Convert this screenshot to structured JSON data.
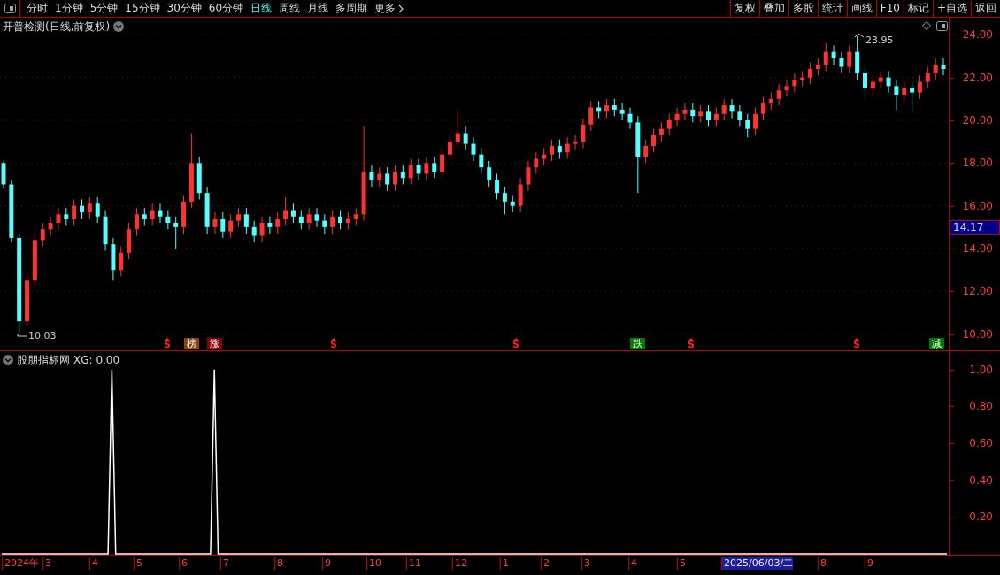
{
  "toolbar": {
    "tabs": [
      {
        "label": "分时",
        "selected": false
      },
      {
        "label": "1分钟",
        "selected": false
      },
      {
        "label": "5分钟",
        "selected": false
      },
      {
        "label": "15分钟",
        "selected": false
      },
      {
        "label": "30分钟",
        "selected": false
      },
      {
        "label": "60分钟",
        "selected": false
      },
      {
        "label": "日线",
        "selected": true
      },
      {
        "label": "周线",
        "selected": false
      },
      {
        "label": "月线",
        "selected": false
      },
      {
        "label": "多周期",
        "selected": false
      }
    ],
    "more": "更多",
    "buttons": [
      "复权",
      "叠加",
      "多股",
      "统计",
      "画线",
      "F10",
      "标记",
      "+自选",
      "返回"
    ]
  },
  "price_chart": {
    "title": "开普检测(日线,前复权)",
    "high_label": "23.95",
    "low_label": "10.03",
    "current_price": "14.17",
    "chart_data": {
      "type": "candlestick",
      "categories": [
        null,
        null,
        null,
        null,
        null,
        null,
        null,
        null,
        null,
        null,
        null,
        null,
        null,
        null,
        null,
        null,
        null,
        null,
        null,
        null,
        null,
        null,
        null,
        null,
        null,
        null,
        null,
        null,
        null,
        null,
        null,
        null,
        null,
        null,
        null,
        null,
        null,
        null,
        null,
        null,
        null,
        null,
        null,
        null,
        null,
        null,
        null,
        null,
        null,
        null,
        null,
        null,
        null,
        null,
        null,
        null,
        null,
        null,
        null,
        null,
        null,
        null,
        null,
        null,
        null,
        null,
        null,
        null,
        null,
        null,
        null,
        null,
        null,
        null,
        null,
        null,
        null,
        null,
        null,
        null,
        null,
        null,
        null,
        null,
        null,
        null,
        null,
        null,
        null,
        null,
        null,
        null,
        null,
        null,
        null,
        null,
        null,
        null,
        null,
        null,
        null,
        null,
        null,
        null,
        null,
        null,
        null,
        null,
        null,
        null,
        null,
        null,
        null,
        null,
        null,
        null,
        null,
        null,
        null,
        null,
        null
      ],
      "ohlc": [
        [
          18.0,
          18.1,
          16.8,
          17.0
        ],
        [
          17.0,
          17.2,
          14.3,
          14.5
        ],
        [
          14.5,
          14.7,
          10.03,
          10.6
        ],
        [
          10.6,
          12.8,
          10.4,
          12.5
        ],
        [
          12.5,
          14.7,
          12.3,
          14.4
        ],
        [
          14.4,
          15.2,
          14.1,
          14.9
        ],
        [
          14.9,
          15.5,
          14.6,
          15.2
        ],
        [
          15.2,
          15.9,
          14.9,
          15.6
        ],
        [
          15.6,
          15.9,
          15.1,
          15.4
        ],
        [
          15.4,
          16.3,
          15.1,
          16.0
        ],
        [
          16.0,
          16.3,
          15.4,
          15.7
        ],
        [
          15.7,
          16.4,
          15.4,
          16.1
        ],
        [
          16.1,
          16.4,
          15.2,
          15.5
        ],
        [
          15.5,
          15.8,
          13.9,
          14.2
        ],
        [
          14.2,
          14.5,
          12.5,
          13.0
        ],
        [
          13.0,
          14.1,
          12.7,
          13.8
        ],
        [
          13.8,
          15.2,
          13.5,
          14.9
        ],
        [
          14.9,
          15.9,
          14.6,
          15.6
        ],
        [
          15.6,
          15.9,
          15.1,
          15.4
        ],
        [
          15.4,
          16.1,
          15.1,
          15.8
        ],
        [
          15.8,
          16.1,
          15.2,
          15.5
        ],
        [
          15.5,
          15.8,
          14.9,
          15.2
        ],
        [
          15.2,
          15.5,
          14.0,
          15.0
        ],
        [
          15.0,
          16.5,
          14.7,
          16.2
        ],
        [
          16.2,
          19.4,
          15.9,
          18.0
        ],
        [
          18.0,
          18.3,
          16.3,
          16.6
        ],
        [
          16.6,
          16.9,
          14.7,
          15.0
        ],
        [
          15.0,
          15.7,
          14.7,
          15.4
        ],
        [
          15.4,
          15.7,
          14.5,
          14.8
        ],
        [
          14.8,
          15.6,
          14.5,
          15.3
        ],
        [
          15.3,
          15.9,
          15.0,
          15.6
        ],
        [
          15.6,
          15.9,
          14.7,
          15.0
        ],
        [
          15.0,
          15.3,
          14.3,
          14.6
        ],
        [
          14.6,
          15.5,
          14.3,
          15.2
        ],
        [
          15.2,
          15.5,
          14.7,
          15.0
        ],
        [
          15.0,
          15.7,
          14.7,
          15.4
        ],
        [
          15.4,
          16.4,
          15.1,
          15.8
        ],
        [
          15.8,
          16.1,
          15.2,
          15.5
        ],
        [
          15.5,
          15.8,
          14.9,
          15.2
        ],
        [
          15.2,
          15.9,
          14.9,
          15.6
        ],
        [
          15.6,
          15.9,
          15.0,
          15.3
        ],
        [
          15.3,
          15.6,
          14.7,
          15.0
        ],
        [
          15.0,
          15.8,
          14.7,
          15.5
        ],
        [
          15.5,
          15.8,
          14.9,
          15.2
        ],
        [
          15.2,
          15.7,
          14.9,
          15.4
        ],
        [
          15.4,
          15.9,
          15.1,
          15.6
        ],
        [
          15.6,
          19.7,
          15.3,
          17.6
        ],
        [
          17.6,
          17.9,
          16.9,
          17.2
        ],
        [
          17.2,
          17.8,
          16.9,
          17.5
        ],
        [
          17.5,
          17.8,
          16.7,
          17.0
        ],
        [
          17.0,
          17.9,
          16.7,
          17.6
        ],
        [
          17.6,
          17.9,
          17.0,
          17.3
        ],
        [
          17.3,
          18.2,
          17.0,
          17.9
        ],
        [
          17.9,
          18.2,
          17.2,
          17.5
        ],
        [
          17.5,
          18.3,
          17.2,
          18.0
        ],
        [
          18.0,
          18.3,
          17.3,
          17.6
        ],
        [
          17.6,
          18.7,
          17.3,
          18.4
        ],
        [
          18.4,
          19.3,
          18.1,
          19.0
        ],
        [
          19.0,
          20.4,
          18.7,
          19.4
        ],
        [
          19.4,
          19.7,
          18.6,
          18.9
        ],
        [
          18.9,
          19.2,
          18.1,
          18.4
        ],
        [
          18.4,
          18.7,
          17.5,
          17.8
        ],
        [
          17.8,
          18.1,
          16.9,
          17.2
        ],
        [
          17.2,
          17.5,
          16.3,
          16.6
        ],
        [
          16.6,
          16.9,
          15.6,
          16.2
        ],
        [
          16.2,
          16.5,
          15.7,
          16.0
        ],
        [
          16.0,
          17.3,
          15.7,
          17.0
        ],
        [
          17.0,
          18.1,
          16.7,
          17.8
        ],
        [
          17.8,
          18.5,
          17.5,
          18.2
        ],
        [
          18.2,
          18.7,
          17.9,
          18.4
        ],
        [
          18.4,
          19.1,
          18.1,
          18.8
        ],
        [
          18.8,
          19.1,
          18.2,
          18.5
        ],
        [
          18.5,
          19.2,
          18.2,
          18.9
        ],
        [
          18.9,
          19.3,
          18.6,
          19.0
        ],
        [
          19.0,
          20.1,
          18.7,
          19.8
        ],
        [
          19.8,
          20.9,
          19.5,
          20.6
        ],
        [
          20.6,
          20.9,
          20.1,
          20.4
        ],
        [
          20.4,
          21.0,
          20.1,
          20.7
        ],
        [
          20.7,
          21.0,
          20.2,
          20.5
        ],
        [
          20.5,
          20.8,
          20.0,
          20.3
        ],
        [
          20.3,
          20.6,
          19.6,
          19.9
        ],
        [
          19.9,
          20.2,
          16.6,
          18.3
        ],
        [
          18.3,
          19.1,
          18.0,
          18.8
        ],
        [
          18.8,
          19.6,
          18.5,
          19.3
        ],
        [
          19.3,
          19.9,
          19.0,
          19.6
        ],
        [
          19.6,
          20.3,
          19.3,
          20.0
        ],
        [
          20.0,
          20.6,
          19.7,
          20.3
        ],
        [
          20.3,
          20.8,
          20.0,
          20.5
        ],
        [
          20.5,
          20.8,
          19.9,
          20.2
        ],
        [
          20.2,
          20.7,
          19.9,
          20.4
        ],
        [
          20.4,
          20.7,
          19.7,
          20.0
        ],
        [
          20.0,
          20.6,
          19.7,
          20.3
        ],
        [
          20.3,
          21.0,
          20.0,
          20.7
        ],
        [
          20.7,
          21.0,
          20.1,
          20.4
        ],
        [
          20.4,
          20.7,
          19.7,
          20.0
        ],
        [
          20.0,
          20.3,
          19.2,
          19.6
        ],
        [
          19.6,
          20.6,
          19.3,
          20.3
        ],
        [
          20.3,
          21.1,
          20.0,
          20.8
        ],
        [
          20.8,
          21.3,
          20.5,
          21.0
        ],
        [
          21.0,
          21.7,
          20.7,
          21.4
        ],
        [
          21.4,
          21.9,
          21.1,
          21.6
        ],
        [
          21.6,
          22.2,
          21.3,
          21.9
        ],
        [
          21.9,
          22.3,
          21.6,
          22.0
        ],
        [
          22.0,
          22.7,
          21.7,
          22.4
        ],
        [
          22.4,
          22.9,
          22.1,
          22.6
        ],
        [
          22.6,
          23.6,
          22.3,
          23.2
        ],
        [
          23.2,
          23.5,
          22.6,
          22.9
        ],
        [
          22.9,
          23.2,
          22.2,
          22.5
        ],
        [
          22.5,
          23.5,
          22.2,
          23.2
        ],
        [
          23.2,
          23.95,
          21.9,
          22.2
        ],
        [
          22.2,
          22.5,
          21.0,
          21.5
        ],
        [
          21.5,
          22.1,
          21.2,
          21.8
        ],
        [
          21.8,
          22.3,
          21.5,
          22.0
        ],
        [
          22.0,
          22.3,
          21.3,
          21.6
        ],
        [
          21.6,
          21.9,
          20.5,
          21.2
        ],
        [
          21.2,
          21.8,
          20.9,
          21.5
        ],
        [
          21.5,
          21.8,
          20.4,
          21.3
        ],
        [
          21.3,
          22.1,
          21.0,
          21.8
        ],
        [
          21.8,
          22.5,
          21.5,
          22.2
        ],
        [
          22.2,
          22.9,
          21.9,
          22.6
        ],
        [
          22.6,
          22.9,
          22.1,
          22.4
        ]
      ],
      "ylim": [
        9.2,
        24.8
      ],
      "grid": true,
      "yticks": [
        {
          "value": 24,
          "label": "24.00"
        },
        {
          "value": 22,
          "label": "22.00"
        },
        {
          "value": 20,
          "label": "20.00"
        },
        {
          "value": 18,
          "label": "18.00"
        },
        {
          "value": 16,
          "label": "16.00"
        },
        {
          "value": 14,
          "label": "14.00"
        },
        {
          "value": 12,
          "label": "12.00"
        },
        {
          "value": 10,
          "label": "10.00"
        }
      ]
    },
    "signals": [
      {
        "kind": "arrow",
        "text": "S",
        "color": "#ff2020"
      },
      {
        "kind": "badge",
        "text": "榜",
        "color": "#8b4513"
      },
      {
        "kind": "badge",
        "text": "涨",
        "color": "#8b0000"
      },
      {
        "kind": "arrow",
        "text": "S",
        "color": "#ff2020"
      },
      {
        "kind": "arrow",
        "text": "S",
        "color": "#ff2020"
      },
      {
        "kind": "badge",
        "text": "跌",
        "color": "#007a00"
      },
      {
        "kind": "arrow",
        "text": "S",
        "color": "#ff2020"
      },
      {
        "kind": "arrow",
        "text": "S",
        "color": "#ff2020"
      },
      {
        "kind": "badge",
        "text": "减",
        "color": "#007a00"
      }
    ]
  },
  "indicator": {
    "title": "股朋指标网",
    "reading": ": 0.00",
    "chart_data": {
      "type": "line",
      "categories": [
        null,
        null,
        null,
        null,
        null,
        null,
        null,
        null,
        null,
        null,
        null,
        null,
        null,
        null,
        null,
        null,
        null,
        null,
        null,
        null,
        null,
        null,
        null,
        null,
        null,
        null,
        null,
        null,
        null,
        null,
        null,
        null,
        null,
        null,
        null,
        null,
        null,
        null,
        null,
        null,
        null,
        null,
        null,
        null,
        null,
        null,
        null,
        null,
        null,
        null,
        null,
        null,
        null,
        null,
        null,
        null,
        null,
        null,
        null,
        null,
        null,
        null,
        null,
        null,
        null,
        null,
        null,
        null,
        null,
        null,
        null,
        null,
        null,
        null,
        null,
        null,
        null,
        null,
        null,
        null,
        null,
        null,
        null,
        null,
        null,
        null,
        null,
        null,
        null,
        null,
        null,
        null,
        null,
        null,
        null,
        null,
        null,
        null,
        null,
        null,
        null,
        null,
        null,
        null,
        null,
        null,
        null,
        null,
        null,
        null,
        null,
        null,
        null,
        null,
        null,
        null,
        null,
        null,
        null,
        null,
        null,
        null,
        null,
        null,
        null,
        null,
        null,
        null,
        null,
        null,
        null,
        null,
        null,
        null,
        null,
        null,
        null,
        null,
        null,
        null,
        null,
        null,
        null,
        null,
        null,
        null,
        null,
        null,
        null,
        null,
        null,
        null,
        null,
        null,
        null,
        null,
        null,
        null,
        null,
        null,
        null,
        null,
        null,
        null,
        null,
        null,
        null,
        null,
        null,
        null,
        null,
        null,
        null,
        null,
        null,
        null,
        null,
        null,
        null,
        null,
        null,
        null,
        null,
        null,
        null,
        null,
        null,
        null,
        null,
        null,
        null,
        null,
        null,
        null,
        null,
        null,
        null,
        null,
        null,
        null,
        null,
        null,
        null,
        null,
        null,
        null,
        null,
        null,
        null,
        null,
        null,
        null,
        null,
        null,
        null,
        null,
        null,
        null,
        null,
        null,
        null,
        null,
        null,
        null,
        null,
        null,
        null,
        null,
        null,
        null,
        null,
        null,
        null,
        null,
        null,
        null,
        null,
        null,
        null,
        null,
        null,
        null,
        null,
        null,
        null,
        null,
        null,
        null,
        null,
        null
      ],
      "series": [
        {
          "name": "XG",
          "color": "#ffffff",
          "values": [
            0,
            0,
            0,
            0,
            0,
            0,
            0,
            0,
            0,
            0,
            0,
            0,
            0,
            0,
            0,
            0,
            0,
            0,
            0,
            0,
            0,
            0,
            0,
            0,
            0,
            0,
            0,
            0,
            0,
            1,
            0,
            0,
            0,
            0,
            0,
            0,
            0,
            0,
            0,
            0,
            0,
            0,
            0,
            0,
            0,
            0,
            0,
            0,
            0,
            0,
            0,
            0,
            0,
            0,
            0,
            0,
            1,
            0,
            0,
            0,
            0,
            0,
            0,
            0,
            0,
            0,
            0,
            0,
            0,
            0,
            0,
            0,
            0,
            0,
            0,
            0,
            0,
            0,
            0,
            0,
            0,
            0,
            0,
            0,
            0,
            0,
            0,
            0,
            0,
            0,
            0,
            0,
            0,
            0,
            0,
            0,
            0,
            0,
            0,
            0,
            0,
            0,
            0,
            0,
            0,
            0,
            0,
            0,
            0,
            0,
            0,
            0,
            0,
            0,
            0,
            0,
            0,
            0,
            0,
            0,
            0,
            0,
            0,
            0,
            0,
            0,
            0,
            0,
            0,
            0,
            0,
            0,
            0,
            0,
            0,
            0,
            0,
            0,
            0,
            0,
            0,
            0,
            0,
            0,
            0,
            0,
            0,
            0,
            0,
            0,
            0,
            0,
            0,
            0,
            0,
            0,
            0,
            0,
            0,
            0,
            0,
            0,
            0,
            0,
            0,
            0,
            0,
            0,
            0,
            0,
            0,
            0,
            0,
            0,
            0,
            0,
            0,
            0,
            0,
            0,
            0,
            0,
            0,
            0,
            0,
            0,
            0,
            0,
            0,
            0,
            0,
            0,
            0,
            0,
            0,
            0,
            0,
            0,
            0,
            0,
            0,
            0,
            0,
            0,
            0,
            0,
            0,
            0,
            0,
            0,
            0,
            0,
            0,
            0,
            0,
            0,
            0,
            0,
            0,
            0,
            0,
            0,
            0,
            0,
            0,
            0,
            0,
            0,
            0,
            0,
            0,
            0,
            0,
            0,
            0,
            0,
            0,
            0,
            0,
            0,
            0,
            0,
            0,
            0,
            0,
            0,
            0,
            0,
            0,
            0
          ]
        }
      ],
      "ylim": [
        0,
        1.1
      ],
      "yticks": [
        {
          "value": 1,
          "label": "1.00"
        },
        {
          "value": 0.8,
          "label": "0.80"
        },
        {
          "value": 0.6,
          "label": "0.60"
        },
        {
          "value": 0.4,
          "label": "0.40"
        },
        {
          "value": 0.2,
          "label": "0.20"
        }
      ]
    }
  },
  "date_axis": [
    {
      "label": "2024年",
      "selected": false
    },
    {
      "label": "3",
      "selected": false
    },
    {
      "label": "4",
      "selected": false
    },
    {
      "label": "5",
      "selected": false
    },
    {
      "label": "6",
      "selected": false
    },
    {
      "label": "7",
      "selected": false
    },
    {
      "label": "8",
      "selected": false
    },
    {
      "label": "9",
      "selected": false
    },
    {
      "label": "10",
      "selected": false
    },
    {
      "label": "11",
      "selected": false
    },
    {
      "label": "12",
      "selected": false
    },
    {
      "label": "1",
      "selected": false
    },
    {
      "label": "2",
      "selected": false
    },
    {
      "label": "3",
      "selected": false
    },
    {
      "label": "4",
      "selected": false
    },
    {
      "label": "5",
      "selected": false
    },
    {
      "label": "2025/06/03/二",
      "selected": true
    },
    {
      "label": "8",
      "selected": false
    },
    {
      "label": "9",
      "selected": false
    }
  ]
}
